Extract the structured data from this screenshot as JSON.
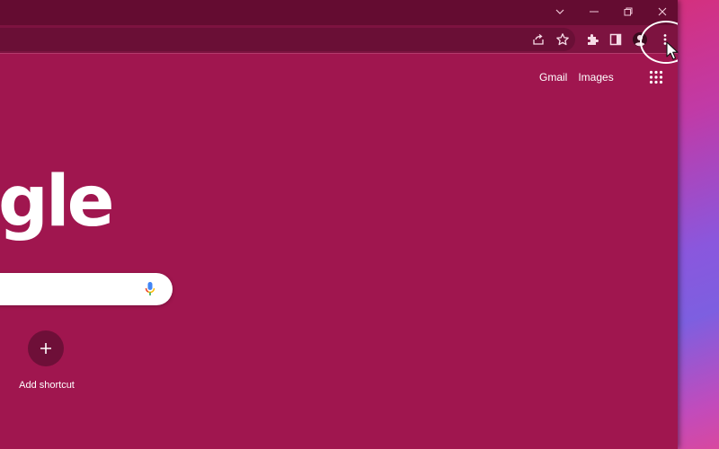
{
  "window_controls": {
    "icons": [
      "chevron-down-icon",
      "minimize-icon",
      "restore-icon",
      "close-icon"
    ]
  },
  "toolbar": {
    "icons": [
      "share-icon",
      "star-icon",
      "extensions-icon",
      "side-panel-icon",
      "profile-icon",
      "more-vert-icon"
    ]
  },
  "top_links": {
    "gmail": "Gmail",
    "images": "Images"
  },
  "logo": {
    "text": "gle"
  },
  "shortcut": {
    "label": "Add shortcut"
  },
  "colors": {
    "page_background": "#a0164f",
    "titlebar": "#640c31",
    "toolbar": "#7d1340",
    "shortcut_circle": "#6e0f38"
  }
}
